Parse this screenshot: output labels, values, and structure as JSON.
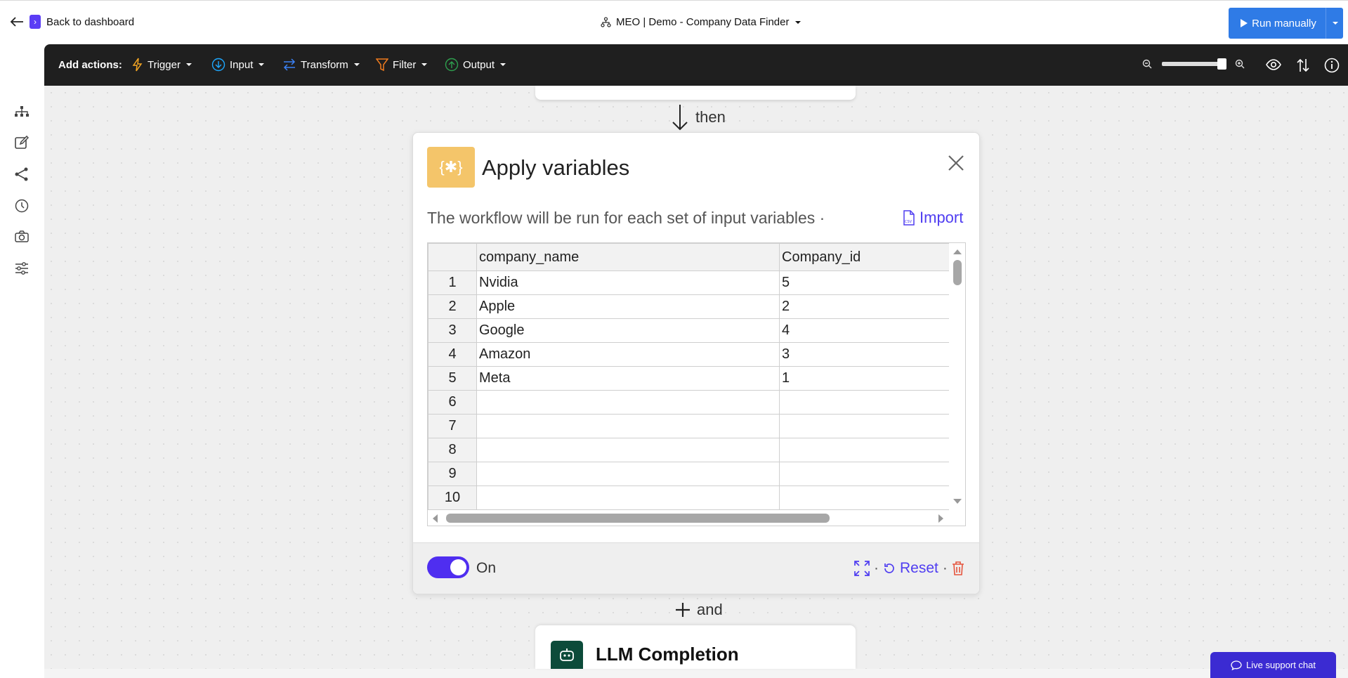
{
  "header": {
    "back_label": "Back to dashboard",
    "workflow_title": "MEO | Demo - Company Data Finder",
    "run_button_label": "Run manually"
  },
  "actionbar": {
    "label": "Add actions:",
    "actions": [
      {
        "label": "Trigger",
        "color": "#f5a623",
        "icon": "lightning-icon"
      },
      {
        "label": "Input",
        "color": "#1ea7fd",
        "icon": "arrow-down-circle-icon"
      },
      {
        "label": "Transform",
        "color": "#3b82f6",
        "icon": "swap-arrows-icon"
      },
      {
        "label": "Filter",
        "color": "#f07c1e",
        "icon": "funnel-icon"
      },
      {
        "label": "Output",
        "color": "#2e9e4e",
        "icon": "arrow-up-circle-icon"
      }
    ],
    "zoom_level": 1.0
  },
  "sidebar": {
    "icons": [
      "hierarchy-icon",
      "edit-icon",
      "share-icon",
      "history-icon",
      "camera-icon",
      "sliders-icon"
    ]
  },
  "connectors": {
    "then_label": "then",
    "and_label": "and"
  },
  "card": {
    "title": "Apply variables",
    "description": "The workflow will be run for each set of input variables ·",
    "import_label": "Import",
    "columns": [
      "company_name",
      "Company_id"
    ],
    "rows": [
      {
        "n": "1",
        "company_name": "Nvidia",
        "company_id": "5"
      },
      {
        "n": "2",
        "company_name": "Apple",
        "company_id": "2"
      },
      {
        "n": "3",
        "company_name": "Google",
        "company_id": "4"
      },
      {
        "n": "4",
        "company_name": "Amazon",
        "company_id": "3"
      },
      {
        "n": "5",
        "company_name": "Meta",
        "company_id": "1"
      },
      {
        "n": "6",
        "company_name": "",
        "company_id": ""
      },
      {
        "n": "7",
        "company_name": "",
        "company_id": ""
      },
      {
        "n": "8",
        "company_name": "",
        "company_id": ""
      },
      {
        "n": "9",
        "company_name": "",
        "company_id": ""
      },
      {
        "n": "10",
        "company_name": "",
        "company_id": ""
      }
    ],
    "toggle_label": "On",
    "toggle_on": true,
    "reset_label": "Reset",
    "separator": "·"
  },
  "next_card": {
    "title": "LLM Completion"
  },
  "support": {
    "label": "Live support chat"
  },
  "colors": {
    "accent": "#4f3df1",
    "run_button": "#2f7be6",
    "badge": "#f4c56a",
    "delete": "#e5533c"
  }
}
